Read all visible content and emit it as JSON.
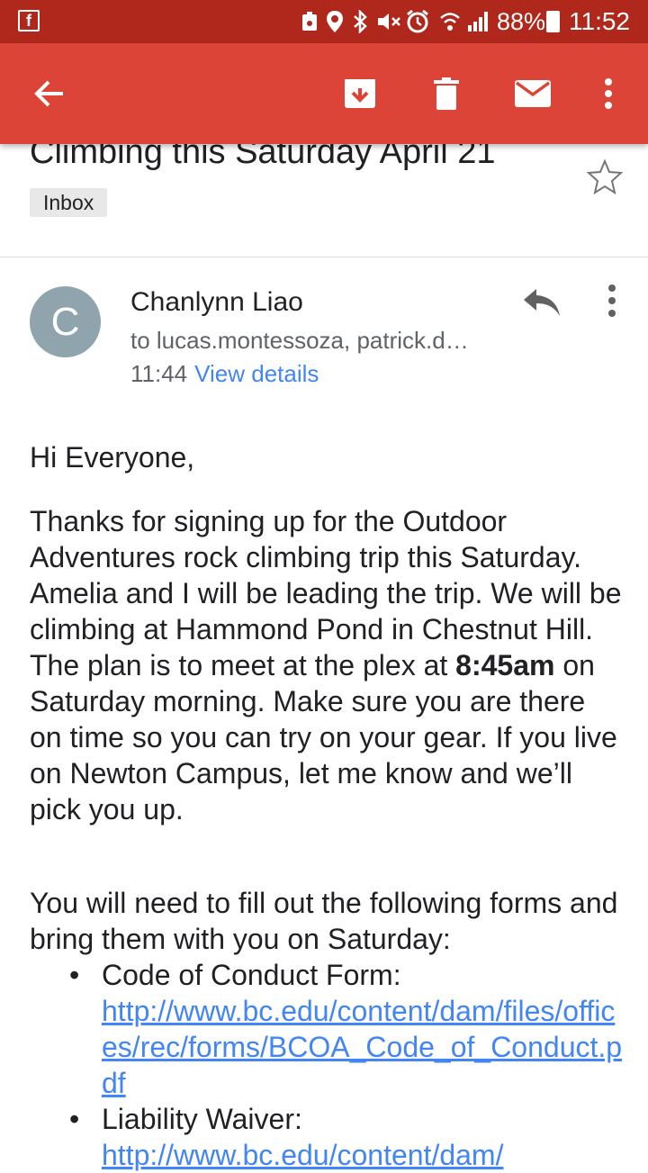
{
  "status_bar": {
    "battery_pct": "88%",
    "time": "11:52",
    "icons": [
      "facebook-icon",
      "notification-icon",
      "location-icon",
      "bluetooth-icon",
      "mute-icon",
      "alarm-icon",
      "wifi-icon",
      "signal-icon"
    ]
  },
  "toolbar": {
    "actions": [
      "back",
      "archive",
      "delete",
      "mark-unread",
      "more"
    ]
  },
  "email": {
    "subject": "Climbing this Saturday April 21",
    "label": "Inbox",
    "avatar_letter": "C",
    "sender": "Chanlynn Liao",
    "recipients": "to lucas.montessoza, patrick.d…",
    "time": "11:44",
    "view_details": "View details",
    "greeting": "Hi Everyone,",
    "para1_before": "Thanks for signing up for the Outdoor Adventures rock climbing trip this Saturday. Amelia and I will be leading the trip. We will be climbing at Hammond Pond in Chestnut Hill. The plan is to meet at the plex at ",
    "para1_bold": "8:45am",
    "para1_after": " on Saturday morning. Make sure you are there on time so you can try on your gear. If you live on Newton Campus, let me know and we’ll pick you up.",
    "para2": "You will need to fill out the following forms and bring them with you on Saturday:",
    "forms": [
      {
        "label": "Code of Conduct Form:",
        "url": "http://www.bc.edu/content/dam/files/offices/rec/forms/BCOA_Code_of_Conduct.pdf"
      },
      {
        "label": "Liability Waiver:",
        "url": "http://www.bc.edu/content/dam/"
      }
    ]
  }
}
